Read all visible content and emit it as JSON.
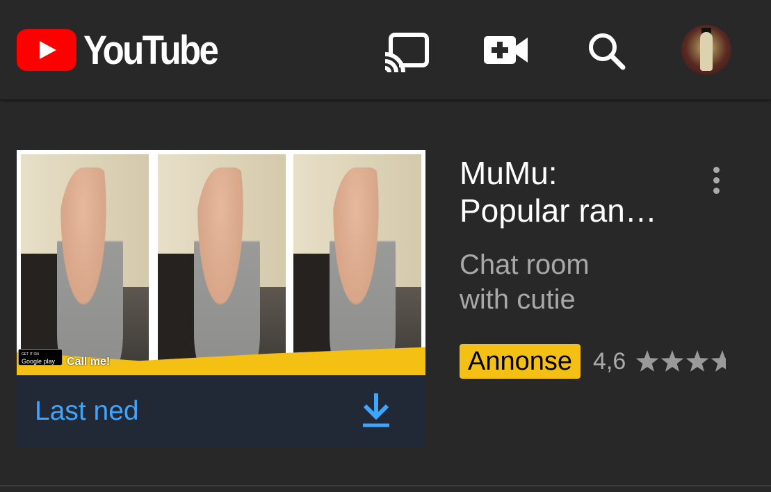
{
  "header": {
    "logo_text": "YouTube",
    "icons": [
      "cast-icon",
      "camera-icon",
      "search-icon",
      "avatar"
    ]
  },
  "ad": {
    "media": {
      "badge_store_small": "GET IT ON",
      "badge_store": "Google play",
      "overlay_text": "Call me!"
    },
    "cta_label": "Last ned",
    "title_line1": "MuMu:",
    "title_line2": "Popular ran…",
    "description_line1": "Chat room",
    "description_line2": "with cutie",
    "badge": "Annonse",
    "rating": "4,6",
    "rating_value": 4.6,
    "rating_max": 5
  },
  "colors": {
    "background": "#282828",
    "brand_red": "#ff0000",
    "cta_blue": "#3ea6ff",
    "ad_badge_yellow": "#f4c013",
    "cta_background": "#212836"
  }
}
